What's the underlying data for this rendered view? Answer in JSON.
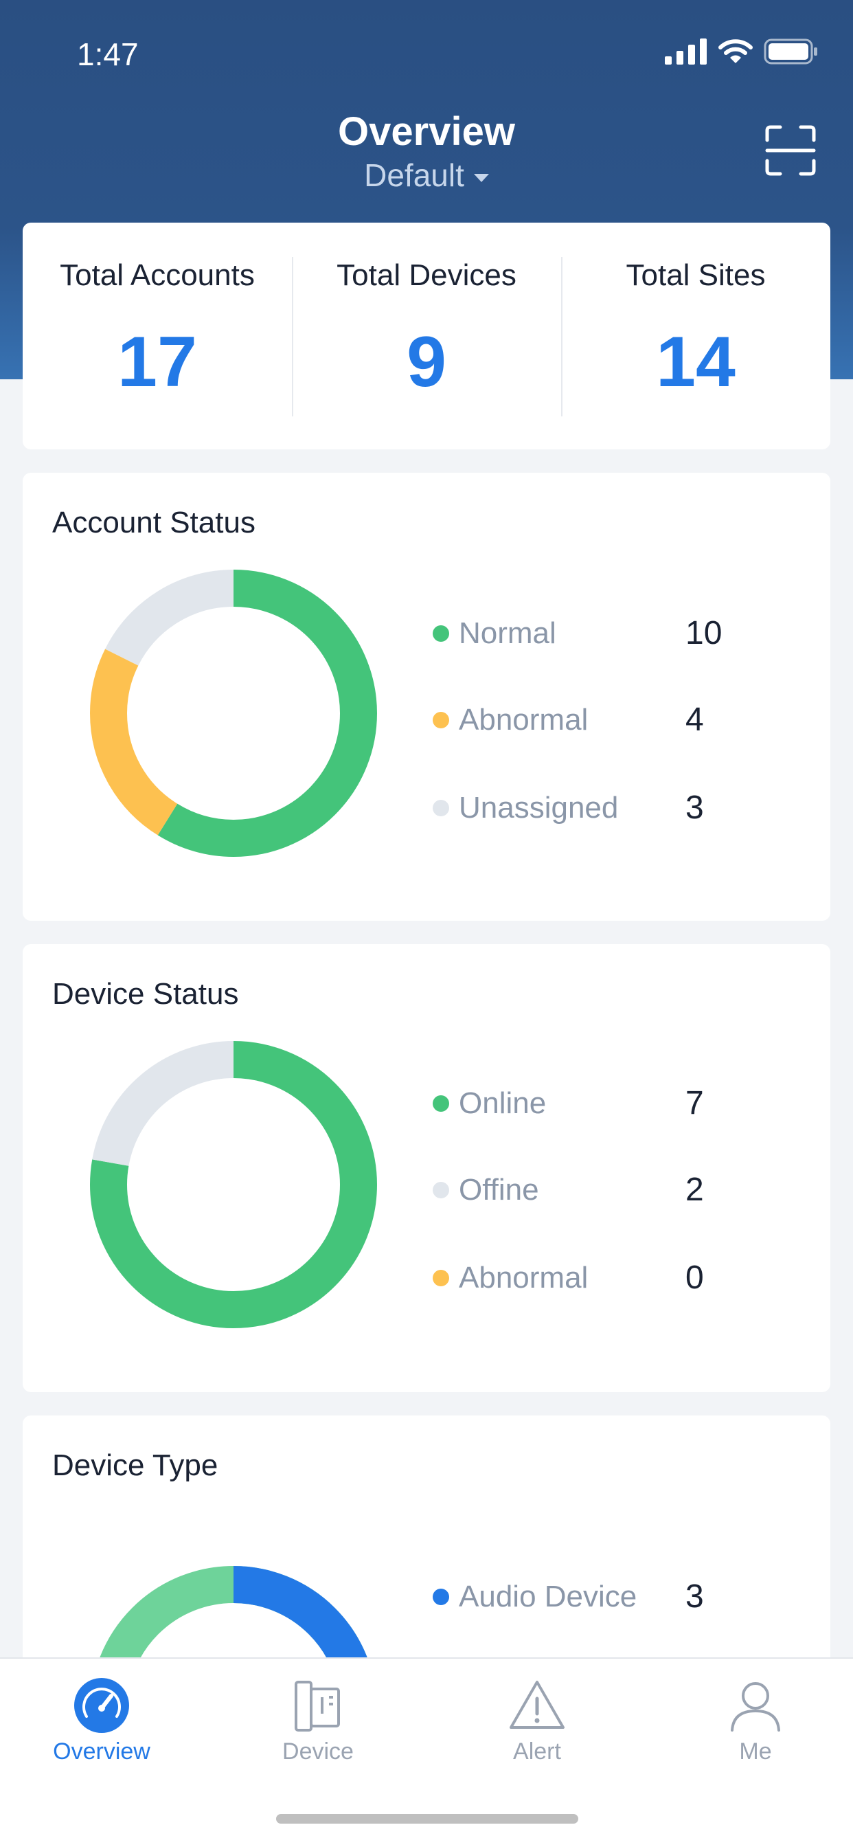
{
  "status_bar": {
    "time": "1:47"
  },
  "header": {
    "title": "Overview",
    "subtitle": "Default"
  },
  "stats": [
    {
      "label": "Total Accounts",
      "value": "17"
    },
    {
      "label": "Total Devices",
      "value": "9"
    },
    {
      "label": "Total Sites",
      "value": "14"
    }
  ],
  "account_status": {
    "title": "Account Status",
    "items": [
      {
        "label": "Normal",
        "value": "10",
        "color": "#44C47A"
      },
      {
        "label": "Abnormal",
        "value": "4",
        "color": "#FDC150"
      },
      {
        "label": "Unassigned",
        "value": "3",
        "color": "#E1E6EC"
      }
    ]
  },
  "device_status": {
    "title": "Device Status",
    "items": [
      {
        "label": "Online",
        "value": "7",
        "color": "#44C47A"
      },
      {
        "label": "Offine",
        "value": "2",
        "color": "#E1E6EC"
      },
      {
        "label": "Abnormal",
        "value": "0",
        "color": "#FDC150"
      }
    ]
  },
  "device_type": {
    "title": "Device Type",
    "items": [
      {
        "label": "Audio Device",
        "value": "3",
        "color": "#2379E6"
      }
    ],
    "other_segment_color": "#6ED39A"
  },
  "tabs": [
    {
      "label": "Overview",
      "icon": "gauge-icon",
      "active": true
    },
    {
      "label": "Device",
      "icon": "device-icon",
      "active": false
    },
    {
      "label": "Alert",
      "icon": "alert-icon",
      "active": false
    },
    {
      "label": "Me",
      "icon": "person-icon",
      "active": false
    }
  ]
}
